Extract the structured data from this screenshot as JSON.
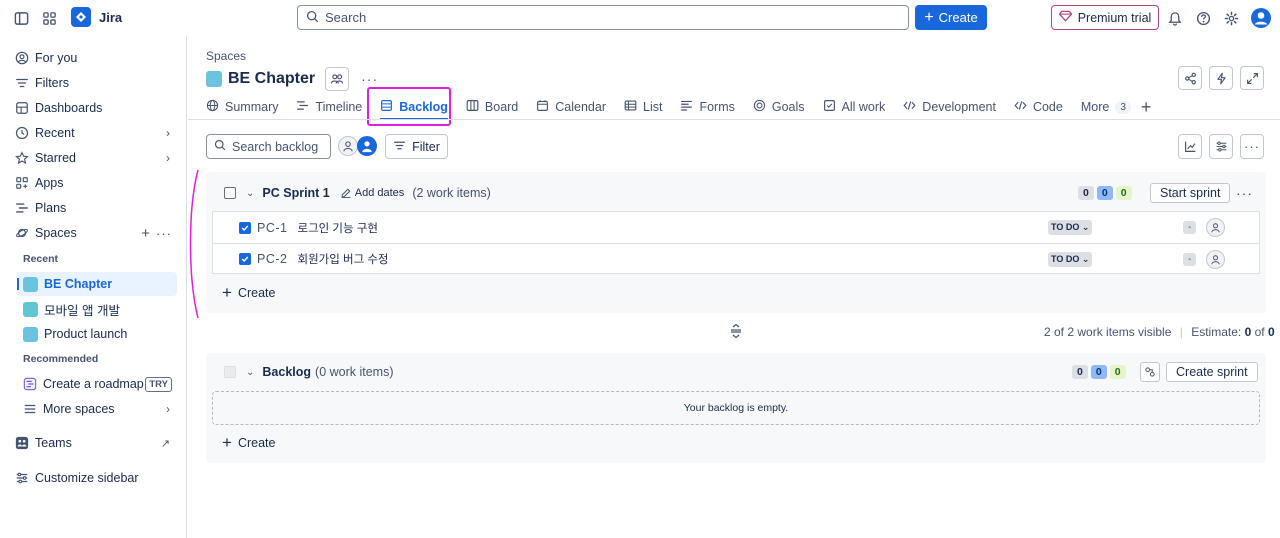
{
  "app": {
    "name": "Jira"
  },
  "topbar": {
    "search_placeholder": "Search",
    "create_label": "Create",
    "premium_label": "Premium trial"
  },
  "sidebar": {
    "for_you": "For you",
    "filters": "Filters",
    "dashboards": "Dashboards",
    "recent": "Recent",
    "starred": "Starred",
    "apps": "Apps",
    "plans": "Plans",
    "spaces": "Spaces",
    "recent_label": "Recent",
    "recent_projects": [
      {
        "name": "BE Chapter",
        "color": "#6cc3e0"
      },
      {
        "name": "모바일 앱 개발",
        "color": "#6cc3e0"
      },
      {
        "name": "Product launch",
        "color": "#6cc3e0"
      }
    ],
    "recommended_label": "Recommended",
    "create_roadmap": "Create a roadmap",
    "try_badge": "TRY",
    "more_spaces": "More spaces",
    "teams": "Teams",
    "customize": "Customize sidebar"
  },
  "header": {
    "breadcrumb": "Spaces",
    "title": "BE Chapter"
  },
  "tabs": [
    {
      "label": "Summary",
      "icon": "globe-icon"
    },
    {
      "label": "Timeline",
      "icon": "timeline-icon"
    },
    {
      "label": "Backlog",
      "icon": "backlog-icon"
    },
    {
      "label": "Board",
      "icon": "board-icon"
    },
    {
      "label": "Calendar",
      "icon": "calendar-icon"
    },
    {
      "label": "List",
      "icon": "list-icon"
    },
    {
      "label": "Forms",
      "icon": "forms-icon"
    },
    {
      "label": "Goals",
      "icon": "goals-icon"
    },
    {
      "label": "All work",
      "icon": "all-work-icon"
    },
    {
      "label": "Development",
      "icon": "code-icon"
    },
    {
      "label": "Code",
      "icon": "code-icon"
    }
  ],
  "more_tab": {
    "label": "More",
    "count": "3"
  },
  "toolbar": {
    "search_placeholder": "Search backlog",
    "filter_label": "Filter"
  },
  "sprint": {
    "name": "PC Sprint 1",
    "add_dates": "Add dates",
    "count": "(2 work items)",
    "points": [
      "0",
      "0",
      "0"
    ],
    "start_label": "Start sprint",
    "issues": [
      {
        "key": "PC-1",
        "summary": "로그인 기능 구현",
        "status": "TO DO",
        "estimate": "-"
      },
      {
        "key": "PC-2",
        "summary": "회원가입 버그 수정",
        "status": "TO DO",
        "estimate": "-"
      }
    ],
    "create_label": "Create"
  },
  "visibility": {
    "text": "2 of 2 work items visible",
    "estimate_label": "Estimate:",
    "estimate_value": "0",
    "estimate_of": "of",
    "estimate_total": "0"
  },
  "backlog": {
    "name": "Backlog",
    "count": "(0 work items)",
    "points": [
      "0",
      "0",
      "0"
    ],
    "create_sprint": "Create sprint",
    "empty": "Your backlog is empty.",
    "create_label": "Create"
  },
  "colors": {
    "brand": "#1868db",
    "highlight": "#e21fd8",
    "premium_border": "#ae4787"
  }
}
